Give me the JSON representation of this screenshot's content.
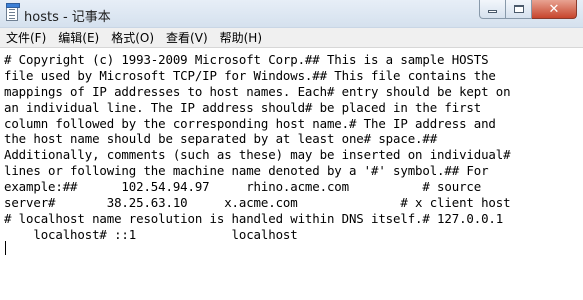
{
  "window": {
    "title": "hosts - 记事本",
    "caption_min_icon": "minimize-icon",
    "caption_max_icon": "maximize-icon",
    "caption_close_icon": "close-icon",
    "close_glyph": "✕"
  },
  "menu": [
    "文件(F)",
    "编辑(E)",
    "格式(O)",
    "查看(V)",
    "帮助(H)"
  ],
  "editor": {
    "lines": [
      "# Copyright (c) 1993-2009 Microsoft Corp.## This is a sample HOSTS",
      "file used by Microsoft TCP/IP for Windows.## This file contains the",
      "mappings of IP addresses to host names. Each# entry should be kept on",
      "an individual line. The IP address should# be placed in the first",
      "column followed by the corresponding host name.# The IP address and",
      "the host name should be separated by at least one# space.##",
      "Additionally, comments (such as these) may be inserted on individual#",
      "lines or following the machine name denoted by a '#' symbol.## For",
      "example:##      102.54.94.97     rhino.acme.com          # source",
      "server#       38.25.63.10     x.acme.com              # x client host",
      "# localhost name resolution is handled within DNS itself.# 127.0.0.1",
      "    localhost# ::1             localhost",
      ""
    ]
  }
}
